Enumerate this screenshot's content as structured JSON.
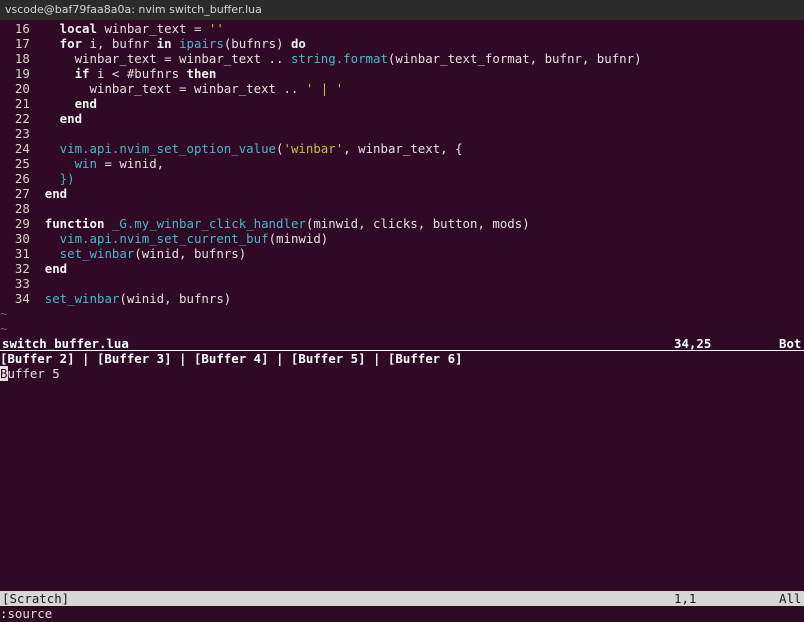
{
  "window": {
    "title": "vscode@baf79faa8a0a: nvim switch_buffer.lua"
  },
  "editor": {
    "lines": [
      {
        "num": "16",
        "tokens": [
          {
            "t": "    local ",
            "c": "kw"
          },
          {
            "t": "winbar_text = ",
            "c": "plain"
          },
          {
            "t": "''",
            "c": "str"
          }
        ]
      },
      {
        "num": "17",
        "tokens": [
          {
            "t": "    for ",
            "c": "kw"
          },
          {
            "t": "i, bufnr ",
            "c": "plain"
          },
          {
            "t": "in ",
            "c": "kw"
          },
          {
            "t": "ipairs",
            "c": "fn"
          },
          {
            "t": "(bufnrs) ",
            "c": "plain"
          },
          {
            "t": "do",
            "c": "kw"
          }
        ]
      },
      {
        "num": "18",
        "tokens": [
          {
            "t": "      winbar_text = winbar_text .. ",
            "c": "plain"
          },
          {
            "t": "string.format",
            "c": "fn"
          },
          {
            "t": "(winbar_text_format, bufnr, bufnr)",
            "c": "plain"
          }
        ]
      },
      {
        "num": "19",
        "tokens": [
          {
            "t": "      if ",
            "c": "kw"
          },
          {
            "t": "i < #bufnrs ",
            "c": "plain"
          },
          {
            "t": "then",
            "c": "kw"
          }
        ]
      },
      {
        "num": "20",
        "tokens": [
          {
            "t": "        winbar_text = winbar_text .. ",
            "c": "plain"
          },
          {
            "t": "' | '",
            "c": "str"
          }
        ]
      },
      {
        "num": "21",
        "tokens": [
          {
            "t": "      end",
            "c": "kw"
          }
        ]
      },
      {
        "num": "22",
        "tokens": [
          {
            "t": "    end",
            "c": "kw"
          }
        ]
      },
      {
        "num": "23",
        "tokens": []
      },
      {
        "num": "24",
        "tokens": [
          {
            "t": "    vim.api.nvim_set_option_value",
            "c": "fn"
          },
          {
            "t": "(",
            "c": "plain"
          },
          {
            "t": "'winbar'",
            "c": "str"
          },
          {
            "t": ", winbar_text, {",
            "c": "plain"
          }
        ]
      },
      {
        "num": "25",
        "tokens": [
          {
            "t": "      win",
            "c": "fn"
          },
          {
            "t": " = winid,",
            "c": "plain"
          }
        ]
      },
      {
        "num": "26",
        "tokens": [
          {
            "t": "    })",
            "c": "fn"
          }
        ]
      },
      {
        "num": "27",
        "tokens": [
          {
            "t": "  end",
            "c": "kw"
          }
        ]
      },
      {
        "num": "28",
        "tokens": []
      },
      {
        "num": "29",
        "tokens": [
          {
            "t": "  function ",
            "c": "kw"
          },
          {
            "t": "_G.my_winbar_click_handler",
            "c": "fn"
          },
          {
            "t": "(minwid, clicks, button, mods)",
            "c": "plain"
          }
        ]
      },
      {
        "num": "30",
        "tokens": [
          {
            "t": "    vim.api.nvim_set_current_buf",
            "c": "fn"
          },
          {
            "t": "(minwid)",
            "c": "plain"
          }
        ]
      },
      {
        "num": "31",
        "tokens": [
          {
            "t": "    set_winbar",
            "c": "fn"
          },
          {
            "t": "(winid, bufnrs)",
            "c": "plain"
          }
        ]
      },
      {
        "num": "32",
        "tokens": [
          {
            "t": "  end",
            "c": "kw"
          }
        ]
      },
      {
        "num": "33",
        "tokens": []
      },
      {
        "num": "34",
        "tokens": [
          {
            "t": "  set_winbar",
            "c": "fn"
          },
          {
            "t": "(winid, bufnrs)",
            "c": "plain"
          }
        ]
      }
    ],
    "tildes": [
      "~",
      "~"
    ],
    "statusline": {
      "filename": "switch_buffer.lua",
      "position": "34,25",
      "percent": "Bot"
    }
  },
  "lower_window": {
    "winbar": "[Buffer 2] | [Buffer 3] | [Buffer 4] | [Buffer 5] | [Buffer 6]",
    "cursor_char": "B",
    "content_rest": "uffer 5",
    "statusline": {
      "filename": "[Scratch]",
      "position": "1,1",
      "percent": "All"
    }
  },
  "cmdline": {
    "text": ":source"
  },
  "colors": {
    "background": "#300a24",
    "keyword": "#f2f2f2",
    "function": "#46b8c8",
    "string": "#d2b84a",
    "tilde": "#6a5f8a"
  }
}
